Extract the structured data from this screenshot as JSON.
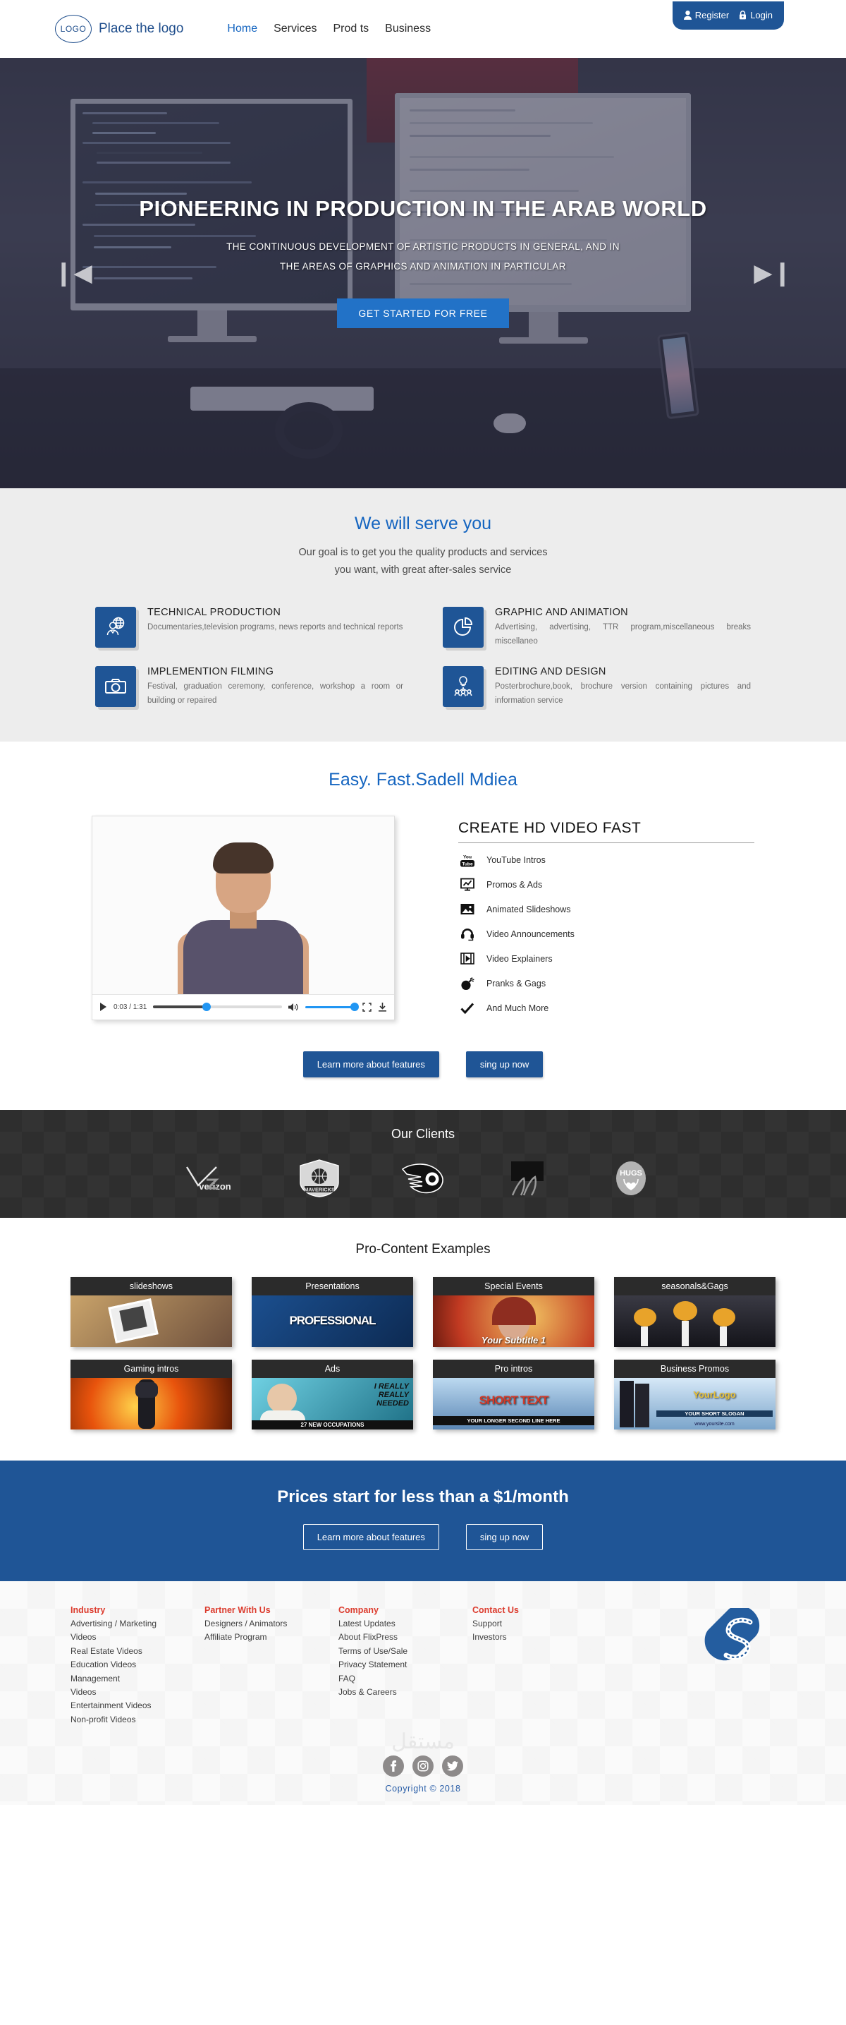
{
  "nav": {
    "logo_badge": "LOGO",
    "logo_text": "Place the logo",
    "links": [
      {
        "label": "Home",
        "active": true
      },
      {
        "label": "Services",
        "active": false
      },
      {
        "label": "Prod ts",
        "active": false
      },
      {
        "label": "Business",
        "active": false
      }
    ],
    "register_label": "Register",
    "login_label": "Login"
  },
  "hero": {
    "title": "PIONEERING IN PRODUCTION IN THE ARAB WORLD",
    "subtitle_line1": "THE CONTINUOUS DEVELOPMENT OF ARTISTIC PRODUCTS IN GENERAL, AND IN",
    "subtitle_line2": "THE AREAS OF GRAPHICS AND ANIMATION IN PARTICULAR",
    "cta_label": "GET STARTED FOR FREE",
    "prev_icon": "carousel-prev-icon",
    "next_icon": "carousel-next-icon"
  },
  "services": {
    "heading": "We will serve you",
    "lead_line1": "Our goal is to get you the quality products and services",
    "lead_line2": "you want, with great after-sales service",
    "items": [
      {
        "icon": "globe-person-icon",
        "title": "TECHNICAL PRODUCTION",
        "desc": "Documentaries,television programs, news reports and technical reports"
      },
      {
        "icon": "pie-chart-icon",
        "title": "GRAPHIC AND ANIMATION",
        "desc": "Advertising, advertising, TTR program,miscellaneous breaks miscellaneo"
      },
      {
        "icon": "camera-icon",
        "title": "IMPLEMENTION  FILMING",
        "desc": "Festival, graduation ceremony, conference, workshop a room or building  or repaired"
      },
      {
        "icon": "lightbulb-team-icon",
        "title": "EDITING AND DESIGN",
        "desc": "Posterbrochure,book, brochure version containing pictures and information  service"
      }
    ]
  },
  "video": {
    "heading": "Easy. Fast.Sadell Mdiea",
    "player": {
      "play_icon": "play-icon",
      "time": "0:03 / 1:31",
      "volume_icon": "volume-icon",
      "fullscreen_icon": "fullscreen-icon",
      "download_icon": "download-icon"
    },
    "list_heading": "CREATE HD VIDEO FAST",
    "list": [
      {
        "icon": "youtube-icon",
        "label": "YouTube Intros"
      },
      {
        "icon": "monitor-chart-icon",
        "label": "Promos & Ads"
      },
      {
        "icon": "image-icon",
        "label": "Animated Slideshows"
      },
      {
        "icon": "headset-icon",
        "label": "Video Announcements"
      },
      {
        "icon": "film-strip-icon",
        "label": "Video Explainers"
      },
      {
        "icon": "bomb-icon",
        "label": "Pranks & Gags"
      },
      {
        "icon": "check-icon",
        "label": "And Much More"
      }
    ],
    "btn_learn": "Learn more about features",
    "btn_signup": "sing up now"
  },
  "clients": {
    "heading": "Our Clients",
    "logos": [
      {
        "name": "verizon-logo",
        "text": "veri  on"
      },
      {
        "name": "dallas-mavericks-logo",
        "text": "MAVERICKS"
      },
      {
        "name": "philadelphia-flyers-logo",
        "text": "P"
      },
      {
        "name": "eagle-logo",
        "text": ""
      },
      {
        "name": "hugs-logo",
        "text": "HUGS"
      }
    ]
  },
  "procontent": {
    "heading": "Pro-Content Examples",
    "tiles": [
      {
        "caption": "slideshows",
        "overlay": "",
        "c1": "#c9a36a",
        "c2": "#6d4f3c"
      },
      {
        "caption": "Presentations",
        "overlay": "PROFESSIONAL",
        "c1": "#1b4f8f",
        "c2": "#0d2a52"
      },
      {
        "caption": "Special Events",
        "overlay": "Your Subtitle 1",
        "c1": "#e8a33a",
        "c2": "#8e2d20"
      },
      {
        "caption": "seasonals&Gags",
        "overlay": "",
        "c1": "#2a2a30",
        "c2": "#4a3c1d"
      },
      {
        "caption": "Gaming intros",
        "overlay": "",
        "c1": "#e86a12",
        "c2": "#5a2405"
      },
      {
        "caption": "Ads",
        "overlay": "27 NEW OCCUPATIONS",
        "c1": "#5cc2d6",
        "c2": "#1d6f85"
      },
      {
        "caption": "Pro intros",
        "overlay": "SHORT TEXT",
        "c1": "#9fc7e8",
        "c2": "#355f86"
      },
      {
        "caption": "Business Promos",
        "overlay": "YourLogo",
        "c1": "#bcd9f0",
        "c2": "#5b87b5"
      }
    ]
  },
  "pricing": {
    "heading": "Prices start for less than a $1/month",
    "btn_learn": "Learn more about features",
    "btn_signup": "sing up now"
  },
  "footer": {
    "columns": [
      {
        "title": "Industry",
        "links": [
          "Advertising / Marketing",
          "Videos",
          "Real Estate Videos",
          "Education Videos",
          "Management",
          "Videos",
          "Entertainment Videos",
          "Non-profit Videos"
        ]
      },
      {
        "title": "Partner With Us",
        "links": [
          "Designers / Animators",
          "Affiliate Program"
        ]
      },
      {
        "title": "Company",
        "links": [
          "Latest Updates",
          "About FlixPress",
          "Terms of Use/Sale",
          "Privacy Statement",
          "FAQ",
          "Jobs & Careers"
        ]
      },
      {
        "title": "Contact Us",
        "links": [
          "Support",
          "Investors"
        ]
      }
    ],
    "brand_logo": "s-swirl-logo",
    "watermark": "مستقل",
    "socials": [
      {
        "name": "facebook-icon",
        "glyph": "f"
      },
      {
        "name": "instagram-icon",
        "glyph": ""
      },
      {
        "name": "twitter-icon",
        "glyph": ""
      }
    ],
    "copyright": "Copyright © 2018"
  },
  "colors": {
    "brand_blue": "#1f5596",
    "link_blue": "#1565c0",
    "hero_btn": "#2272c7",
    "footer_heading_red": "#dc3c2e",
    "dark_band": "#2e2e2e"
  }
}
